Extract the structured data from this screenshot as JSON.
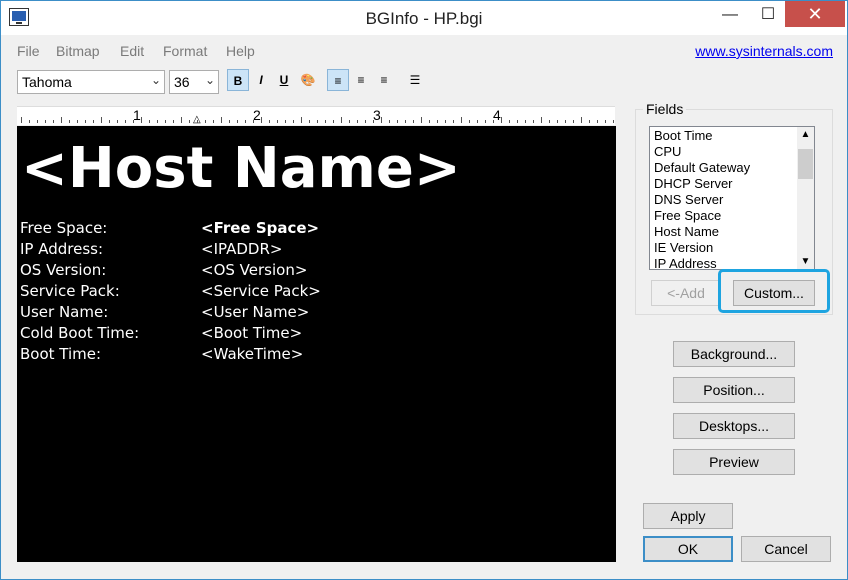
{
  "window": {
    "title": "BGInfo - HP.bgi",
    "min_symbol": "—",
    "max_symbol": "☐",
    "close_symbol": "✕"
  },
  "menu": {
    "items": [
      "File",
      "Bitmap",
      "Edit",
      "Format",
      "Help"
    ],
    "link": "www.sysinternals.com"
  },
  "toolbar": {
    "font": "Tahoma",
    "size": "36",
    "bold": "B",
    "italic": "I",
    "underline": "U",
    "color": "🎨",
    "align_left": "≡",
    "align_center": "≡",
    "align_right": "≡",
    "bullets": "☰"
  },
  "ruler": {
    "numbers": [
      "1",
      "2",
      "3",
      "4"
    ]
  },
  "canvas": {
    "hostname": "<Host Name>",
    "rows": [
      {
        "label": "Free Space:",
        "value": "<Free Space>"
      },
      {
        "label": "IP Address:",
        "value": "<IPADDR>"
      },
      {
        "label": "OS Version:",
        "value": "<OS Version>"
      },
      {
        "label": "Service Pack:",
        "value": "<Service Pack>"
      },
      {
        "label": "User Name:",
        "value": "<User Name>"
      },
      {
        "label": "Cold Boot Time:",
        "value": "<Boot Time>"
      },
      {
        "label": "Boot Time:",
        "value": "<WakeTime>"
      }
    ]
  },
  "fields": {
    "label": "Fields",
    "items": [
      "Boot Time",
      "CPU",
      "Default Gateway",
      "DHCP Server",
      "DNS Server",
      "Free Space",
      "Host Name",
      "IE Version",
      "IP Address"
    ],
    "add_label": "<-Add",
    "custom_label": "Custom..."
  },
  "buttons": {
    "background": "Background...",
    "position": "Position...",
    "desktops": "Desktops...",
    "preview": "Preview",
    "apply": "Apply",
    "ok": "OK",
    "cancel": "Cancel"
  },
  "colors": {
    "accent": "#1ea4e0",
    "close": "#c7504b",
    "canvas": "#000000"
  }
}
